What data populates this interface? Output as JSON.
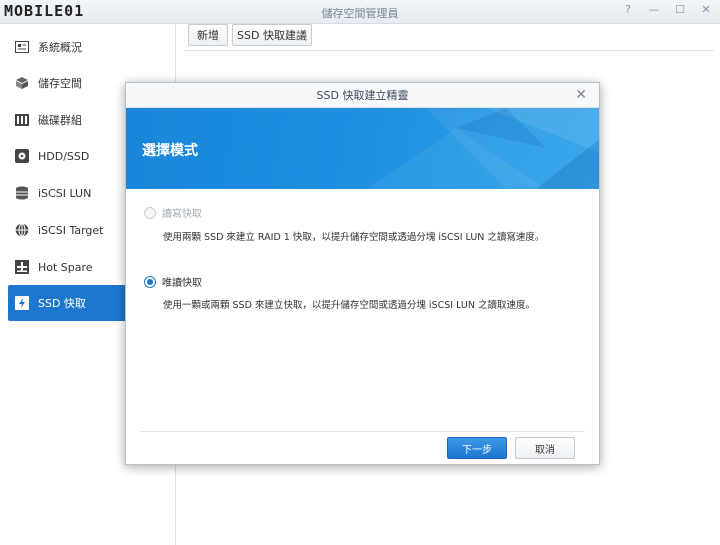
{
  "app": {
    "logo_text": "MOBILE01",
    "title": "儲存空間管理員",
    "controls": [
      "?",
      "—",
      "☐",
      "✕"
    ]
  },
  "sidebar": {
    "items": [
      {
        "label": "系統概況",
        "icon": "overview-icon"
      },
      {
        "label": "儲存空間",
        "icon": "volume-icon"
      },
      {
        "label": "磁碟群組",
        "icon": "disk-group-icon"
      },
      {
        "label": "HDD/SSD",
        "icon": "hdd-icon"
      },
      {
        "label": "iSCSI LUN",
        "icon": "lun-icon"
      },
      {
        "label": "iSCSI Target",
        "icon": "target-icon"
      },
      {
        "label": "Hot Spare",
        "icon": "hot-spare-icon"
      },
      {
        "label": "SSD 快取",
        "icon": "ssd-cache-icon",
        "active": true
      }
    ]
  },
  "toolbar": {
    "create_label": "新增",
    "advisor_label": "SSD 快取建議"
  },
  "dialog": {
    "title": "SSD 快取建立精靈",
    "close": "✕",
    "banner_title": "選擇模式",
    "options": [
      {
        "label": "讀寫快取",
        "description": "使用兩顆 SSD 來建立 RAID 1 快取，以提升儲存空間或透過分塊 iSCSI LUN 之讀寫速度。",
        "selected": false,
        "disabled": true
      },
      {
        "label": "唯讀快取",
        "description": "使用一顆或兩顆 SSD 來建立快取，以提升儲存空間或透過分塊 iSCSI LUN 之讀取速度。",
        "selected": true,
        "disabled": false
      }
    ],
    "next_label": "下一步",
    "cancel_label": "取消"
  },
  "colors": {
    "accent": "#1e77cf",
    "banner": "#1e8fe0"
  }
}
